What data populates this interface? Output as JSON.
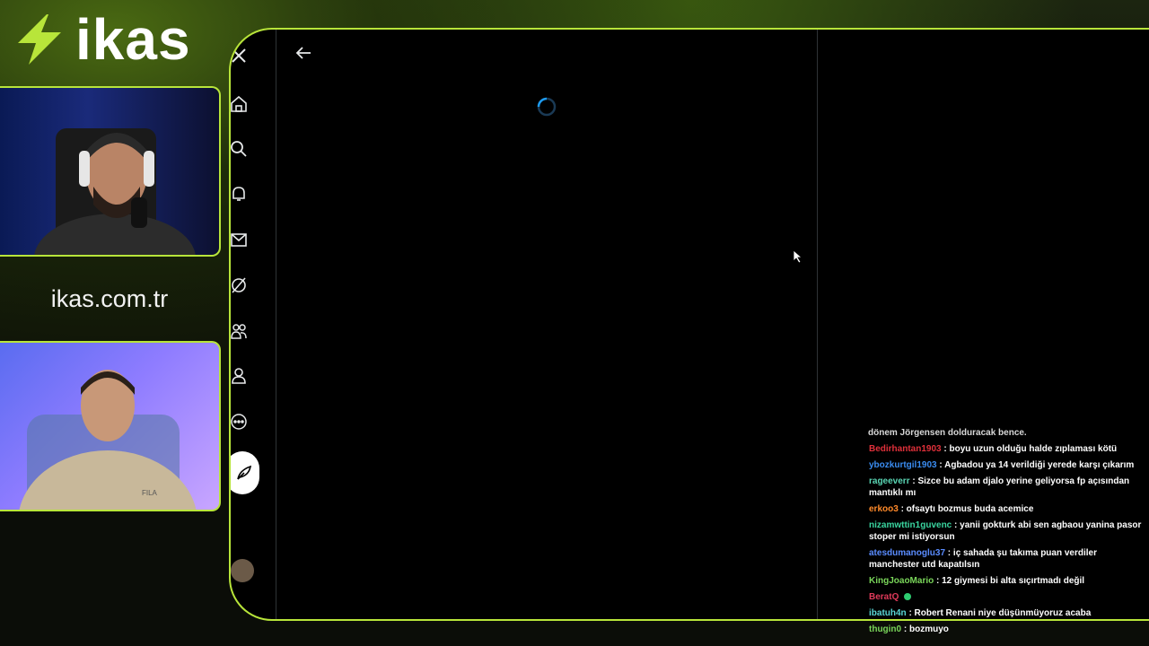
{
  "overlay": {
    "brand": "ikas",
    "site": "ikas.com.tr",
    "accent": "#b8e53a"
  },
  "browser": {
    "nav_icons": [
      "x-logo-icon",
      "home-icon",
      "search-icon",
      "bell-icon",
      "mail-icon",
      "grok-icon",
      "communities-icon",
      "profile-icon",
      "more-icon",
      "post-feather-icon"
    ],
    "loading": true
  },
  "chat": {
    "first_partial": "dönem Jörgensen dolduracak bence.",
    "messages": [
      {
        "user": "Bedirhantan1903",
        "color": "#e0303a",
        "text": "boyu uzun olduğu halde zıplaması kötü"
      },
      {
        "user": "ybozkurtgil1903",
        "color": "#3a8cf0",
        "text": "Agbadou ya 14 verildiği yerede karşı çıkarım"
      },
      {
        "user": "rageeverr",
        "color": "#5ad6b4",
        "text": "Sizce bu adam djalo yerine geliyorsa fp açısından mantıklı mı"
      },
      {
        "user": "erkoo3",
        "color": "#ff8a2a",
        "text": "ofsaytı bozmus buda acemice"
      },
      {
        "user": "nizamwttin1guvenc",
        "color": "#3ad6a0",
        "text": "yanii gokturk abi sen agbaou yanina pasor stoper mi istiyorsun"
      },
      {
        "user": "atesdumanoglu37",
        "color": "#5a8cff",
        "text": "iç sahada şu takıma puan verdiler manchester utd kapatılsın"
      },
      {
        "user": "KingJoaoMario",
        "color": "#7ad65a",
        "text": "12 giymesi bi alta sıçırtmadı değil"
      },
      {
        "user": "BeratQ",
        "color": "#e03a5a",
        "text": ""
      },
      {
        "user": "ibatuh4n",
        "color": "#5ad6d6",
        "text": "Robert Renani niye düşünmüyoruz acaba"
      },
      {
        "user": "thugin0",
        "color": "#7ad65a",
        "text": "bozmuyo"
      }
    ]
  }
}
